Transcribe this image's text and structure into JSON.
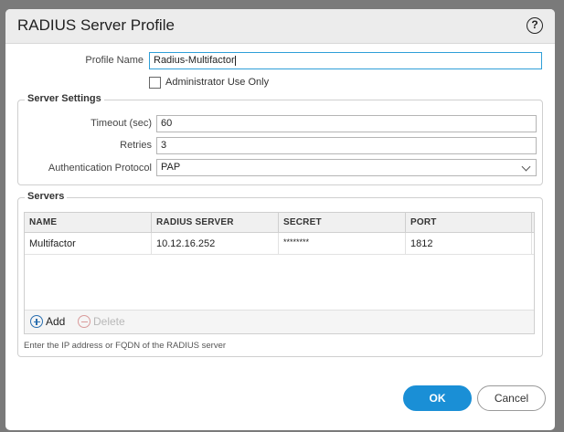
{
  "dialog": {
    "title": "RADIUS Server Profile",
    "help_symbol": "?"
  },
  "profile": {
    "name_label": "Profile Name",
    "name_value": "Radius-Multifactor",
    "admin_only_label": "Administrator Use Only",
    "admin_only_checked": false
  },
  "server_settings": {
    "legend": "Server Settings",
    "timeout_label": "Timeout (sec)",
    "timeout_value": "60",
    "retries_label": "Retries",
    "retries_value": "3",
    "auth_protocol_label": "Authentication Protocol",
    "auth_protocol_value": "PAP"
  },
  "servers": {
    "legend": "Servers",
    "columns": [
      "NAME",
      "RADIUS SERVER",
      "SECRET",
      "PORT"
    ],
    "rows": [
      [
        "Multifactor",
        "10.12.16.252",
        "********",
        "1812"
      ]
    ],
    "add_label": "Add",
    "delete_label": "Delete",
    "hint": "Enter the IP address or FQDN of the RADIUS server"
  },
  "footer": {
    "ok_label": "OK",
    "cancel_label": "Cancel"
  },
  "colors": {
    "accent": "#1a8fd6",
    "focus_border": "#2f9fd8"
  }
}
